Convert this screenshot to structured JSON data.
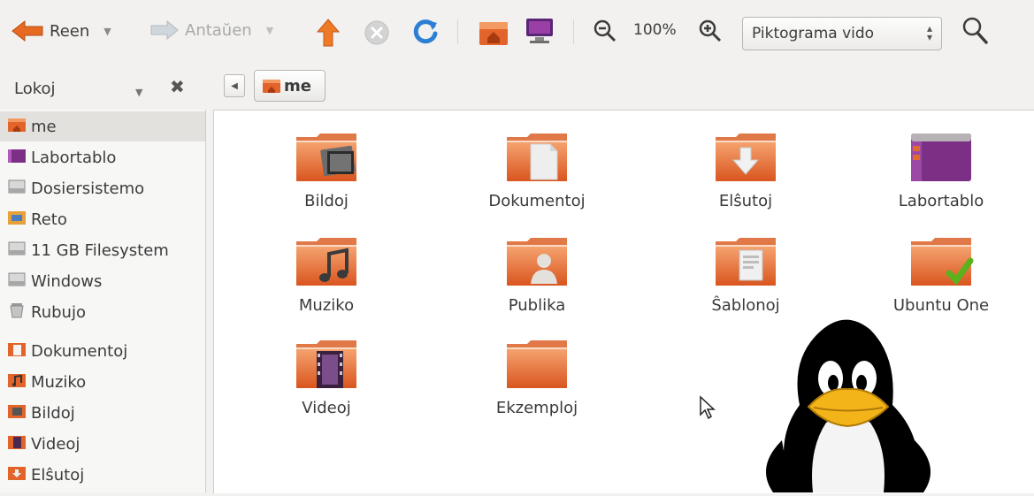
{
  "toolbar": {
    "back_label": "Reen",
    "forward_label": "Antaŭen",
    "zoom_level": "100%",
    "view_mode": "Piktograma vido"
  },
  "location": {
    "sidebar_mode": "Lokoj",
    "breadcrumb": "me"
  },
  "sidebar": {
    "items": [
      {
        "label": "me",
        "icon": "home-folder-icon"
      },
      {
        "label": "Labortablo",
        "icon": "desktop-icon"
      },
      {
        "label": "Dosiersistemo",
        "icon": "drive-icon"
      },
      {
        "label": "Reto",
        "icon": "network-icon"
      },
      {
        "label": "11 GB Filesystem",
        "icon": "drive-icon"
      },
      {
        "label": "Windows",
        "icon": "drive-icon"
      },
      {
        "label": "Rubujo",
        "icon": "trash-icon"
      },
      {
        "label": "Dokumentoj",
        "icon": "documents-icon"
      },
      {
        "label": "Muziko",
        "icon": "music-icon"
      },
      {
        "label": "Bildoj",
        "icon": "pictures-icon"
      },
      {
        "label": "Videoj",
        "icon": "videos-icon"
      },
      {
        "label": "Elŝutoj",
        "icon": "downloads-icon"
      }
    ]
  },
  "files": [
    {
      "name": "Bildoj",
      "emblem": "pictures"
    },
    {
      "name": "Dokumentoj",
      "emblem": "documents"
    },
    {
      "name": "Elŝutoj",
      "emblem": "downloads"
    },
    {
      "name": "Labortablo",
      "emblem": "desktop"
    },
    {
      "name": "Muziko",
      "emblem": "music"
    },
    {
      "name": "Publika",
      "emblem": "public"
    },
    {
      "name": "Ŝablonoj",
      "emblem": "templates"
    },
    {
      "name": "Ubuntu One",
      "emblem": "ubuntu-one"
    },
    {
      "name": "Videoj",
      "emblem": "videos"
    },
    {
      "name": "Ekzemploj",
      "emblem": "plain"
    }
  ],
  "colors": {
    "folder": "#e2642a",
    "folder_light": "#f39a63",
    "accent": "#dd4814",
    "desktop_purple": "#7b2f85"
  }
}
